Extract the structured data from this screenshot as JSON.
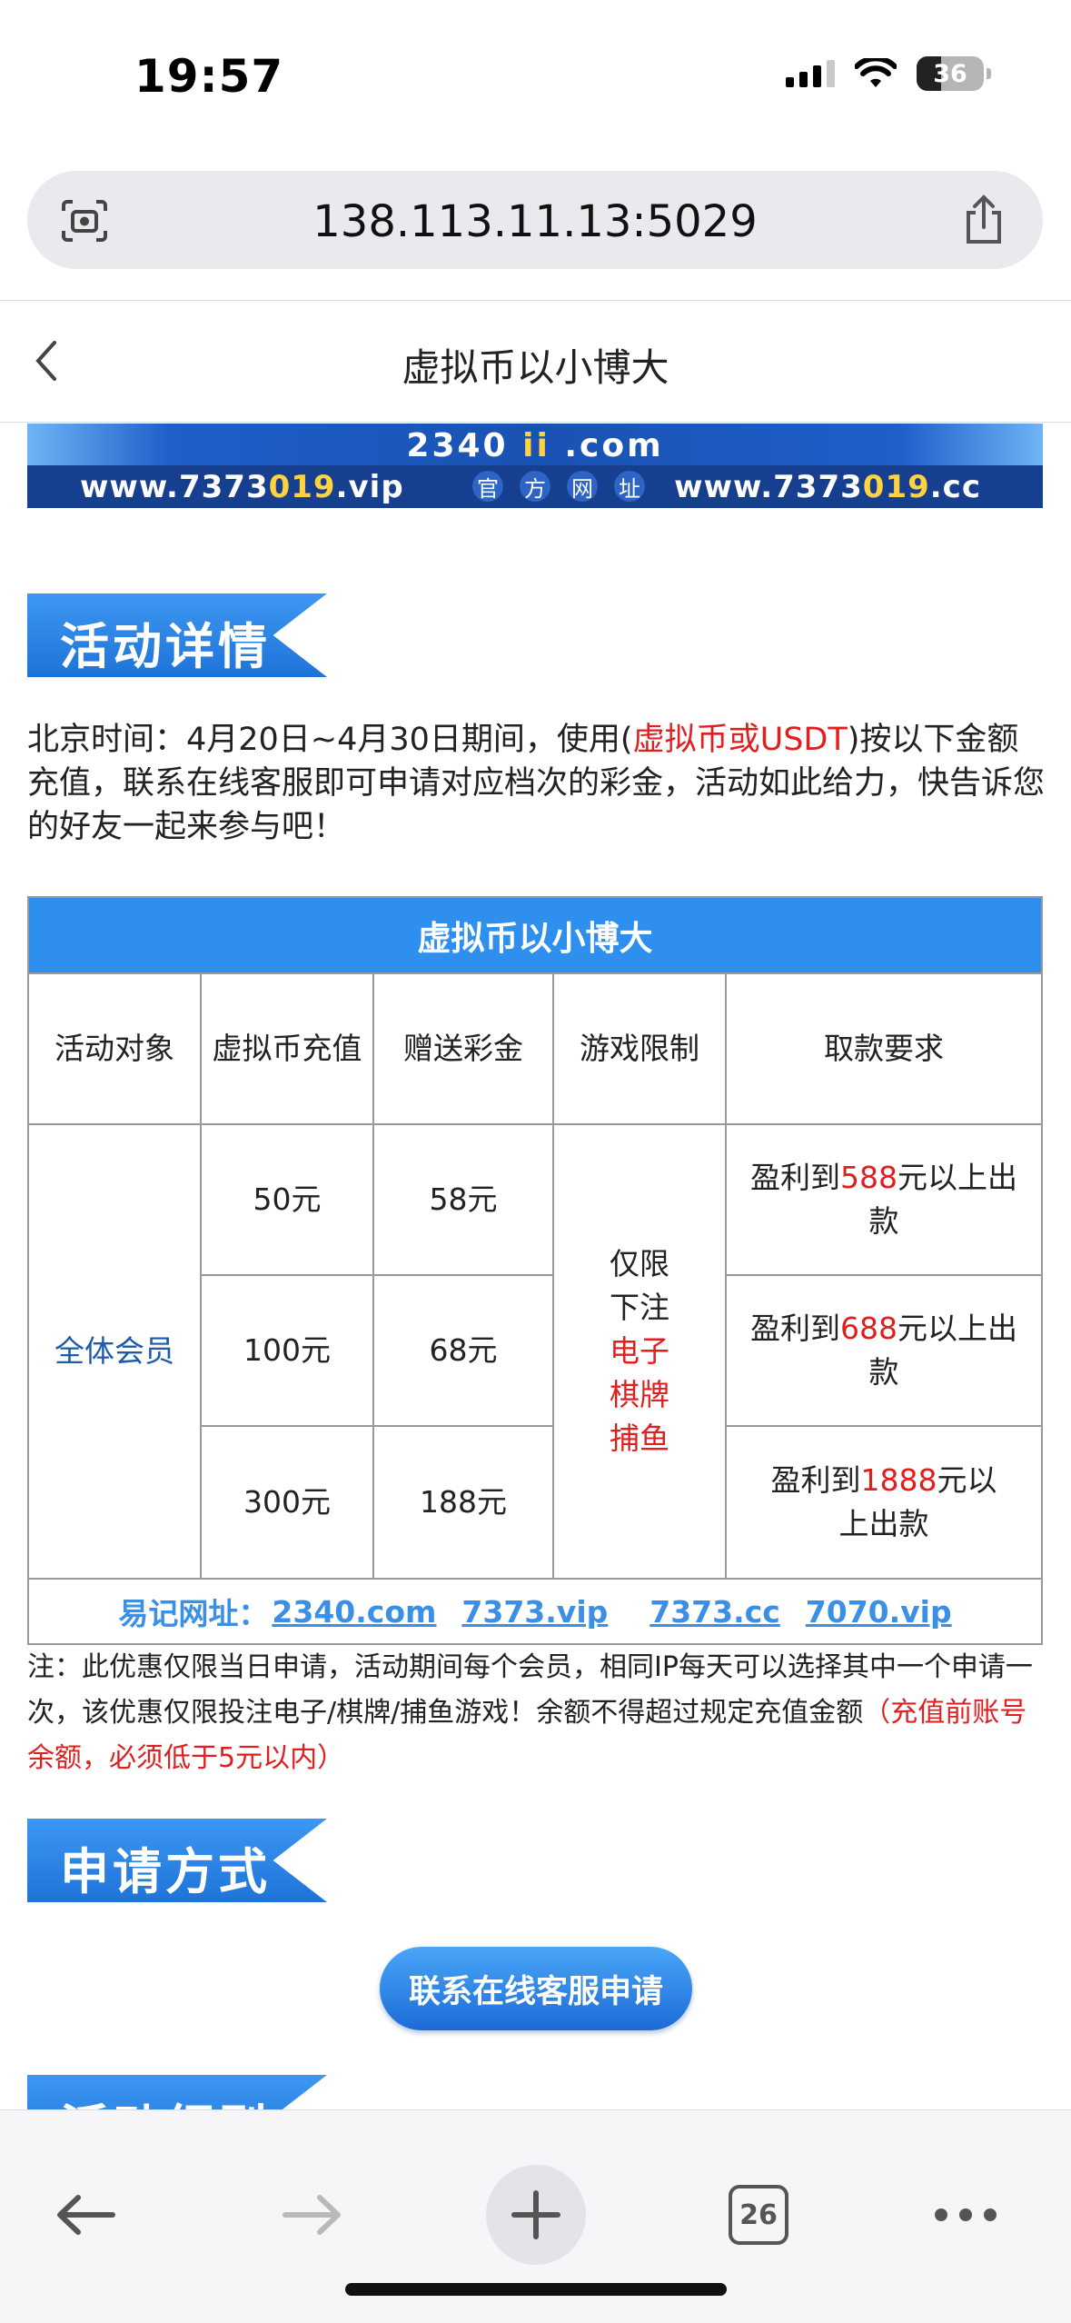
{
  "status": {
    "time": "19:57",
    "battery": "36",
    "battery_level": 0.36
  },
  "browser": {
    "url": "138.113.11.13:5029",
    "tabs_count": "26"
  },
  "header": {
    "title": "虚拟币以小博大"
  },
  "banner": {
    "domain_prefix": "2340 ",
    "domain_mid": "ii",
    "domain_suffix": " .com",
    "left_url_a": "www.7373",
    "left_url_b": "019",
    "left_url_c": ".vip",
    "official": [
      "官",
      "方",
      "网",
      "址"
    ],
    "right_url_a": "www.7373",
    "right_url_b": "019",
    "right_url_c": ".cc"
  },
  "sections": {
    "details": "活动详情",
    "apply": "申请方式",
    "rules_partial": "活动细则"
  },
  "intro": {
    "part1": "北京时间：4月20日~4月30日期间，使用(",
    "highlight": "虚拟币或USDT",
    "part2": ")按以下金额充值，联系在线客服即可申请对应档次的彩金，活动如此给力，快告诉您的好友一起来参与吧！"
  },
  "table": {
    "title": "虚拟币以小博大",
    "headers": [
      "活动对象",
      "虚拟币充值",
      "赠送彩金",
      "游戏限制",
      "取款要求"
    ],
    "target": "全体会员",
    "rows": [
      {
        "deposit": "50元",
        "bonus": "58元",
        "req_a": "盈利到",
        "req_b": "588",
        "req_c": "元以上出款"
      },
      {
        "deposit": "100元",
        "bonus": "68元",
        "req_a": "盈利到",
        "req_b": "688",
        "req_c": "元以上出款"
      },
      {
        "deposit": "300元",
        "bonus": "188元",
        "req_a": "盈利到",
        "req_b": "1888",
        "req_c": "元以上出款"
      }
    ],
    "game_limit": {
      "line1": "仅限",
      "line2": "下注",
      "line3": "电子",
      "line4": "棋牌",
      "line5": "捕鱼"
    },
    "footer_label": "易记网址：",
    "footer_links": [
      "2340.com",
      "7373.vip",
      "7373.cc",
      "7070.vip"
    ]
  },
  "notice": {
    "text": "注：此优惠仅限当日申请，活动期间每个会员，相同IP每天可以选择其中一个申请一次，该优惠仅限投注电子/棋牌/捕鱼游戏！余额不得超过规定充值金额",
    "highlight": "（充值前账号余额，必须低于5元以内）"
  },
  "apply_button": "联系在线客服申请",
  "colors": {
    "accent": "#2e8fee",
    "red": "#e21f1f",
    "link": "#3a8fe6"
  }
}
